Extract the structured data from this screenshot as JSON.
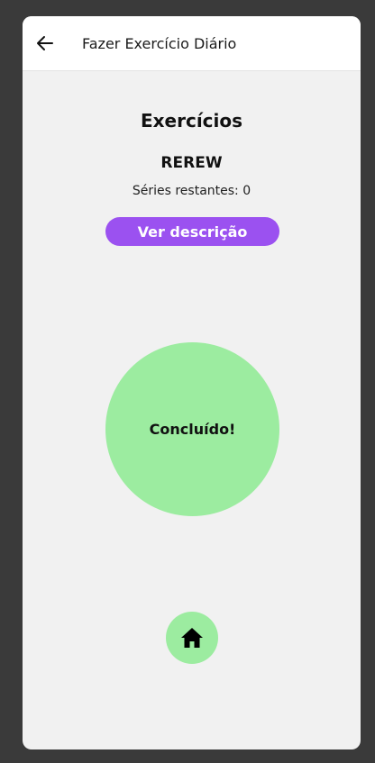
{
  "header": {
    "title": "Fazer Exercício Diário",
    "back_icon": "arrow-left-icon"
  },
  "main": {
    "section_title": "Exercícios",
    "exercise_name": "REREW",
    "series_label": "Séries restantes: 0",
    "description_button": "Ver descrição",
    "done_label": "Concluído!",
    "home_icon": "home-icon"
  },
  "colors": {
    "background": "#f1f1f1",
    "accent_purple": "#9b51f0",
    "success_green": "#9ceca0"
  }
}
